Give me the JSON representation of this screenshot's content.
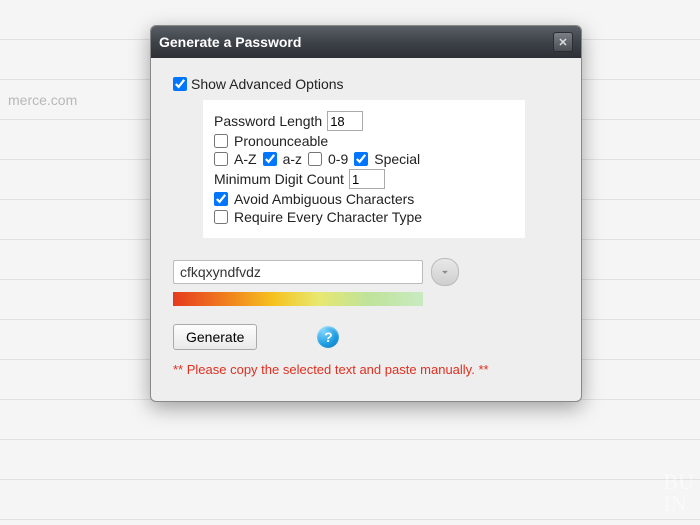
{
  "background": {
    "row_text": "merce.com"
  },
  "dialog": {
    "title": "Generate a Password",
    "show_advanced_label": "Show Advanced Options",
    "show_advanced_checked": true,
    "advanced": {
      "password_length_label": "Password Length",
      "password_length_value": "18",
      "pronounceable_label": "Pronounceable",
      "pronounceable_checked": false,
      "az_upper_label": "A-Z",
      "az_upper_checked": false,
      "az_lower_label": "a-z",
      "az_lower_checked": true,
      "digits_label": "0-9",
      "digits_checked": false,
      "special_label": "Special",
      "special_checked": true,
      "min_digit_label": "Minimum Digit Count",
      "min_digit_value": "1",
      "avoid_ambiguous_label": "Avoid Ambiguous Characters",
      "avoid_ambiguous_checked": true,
      "require_every_label": "Require Every Character Type",
      "require_every_checked": false
    },
    "password_value": "cfkqxyndfvdz",
    "generate_label": "Generate",
    "help_symbol": "?",
    "warning_text": "** Please copy the selected text and paste manually. **"
  },
  "watermark": {
    "line1": "BU",
    "line2": "IN"
  }
}
